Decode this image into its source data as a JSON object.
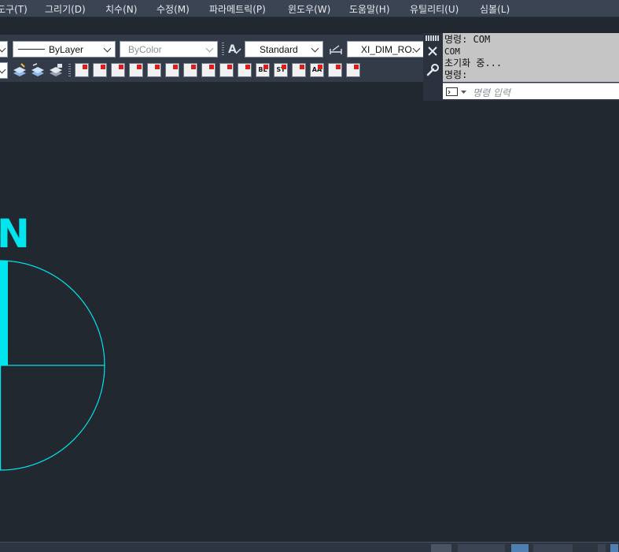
{
  "menubar": {
    "items": [
      "도구(T)",
      "그리기(D)",
      "치수(N)",
      "수정(M)",
      "파라메트릭(P)",
      "윈도우(W)",
      "도움말(H)",
      "유틸리티(U)",
      "심볼(L)"
    ]
  },
  "toolbar": {
    "linetype_value": "ByLayer",
    "color_value": "ByColor",
    "text_style_value": "Standard",
    "dim_style_value": "XI_DIM_RO."
  },
  "dim_buttons": [
    "",
    "",
    "",
    "",
    "",
    "",
    "",
    "",
    "",
    "",
    "BL",
    "ST",
    "",
    "AA",
    "",
    ""
  ],
  "command_window": {
    "history": [
      "명령: COM",
      "COM",
      "초기화 중...",
      "명령:"
    ],
    "input_placeholder": "명령 입력"
  },
  "drawing": {
    "north_label": "N",
    "color": "#00e5ee"
  },
  "colors": {
    "canvas": "#212830",
    "menubar": "#3b4453",
    "cyan": "#00e5ee"
  }
}
